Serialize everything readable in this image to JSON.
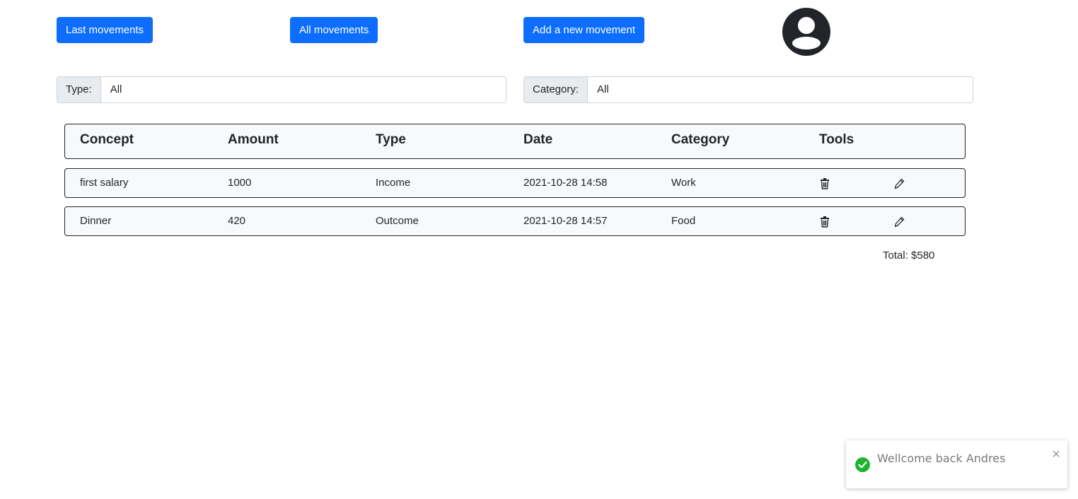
{
  "nav": {
    "last_movements": "Last movements",
    "all_movements": "All movements",
    "add_movement": "Add a new movement"
  },
  "filters": {
    "type_label": "Type:",
    "type_value": "All",
    "category_label": "Category:",
    "category_value": "All"
  },
  "table": {
    "headers": [
      "Concept",
      "Amount",
      "Type",
      "Date",
      "Category",
      "Tools"
    ],
    "rows": [
      {
        "concept": "first salary",
        "amount": "1000",
        "type": "Income",
        "date": "2021-10-28 14:58",
        "category": "Work"
      },
      {
        "concept": "Dinner",
        "amount": "420",
        "type": "Outcome",
        "date": "2021-10-28 14:57",
        "category": "Food"
      }
    ],
    "row_tools": [
      "trash-icon",
      "pencil-icon"
    ]
  },
  "total": "Total: $580",
  "toast": {
    "message": "Wellcome back Andres",
    "close": "×",
    "icon": "check-circle-icon"
  },
  "colors": {
    "primary": "#0d6efd",
    "success": "#1db32f",
    "dark": "#212529"
  }
}
